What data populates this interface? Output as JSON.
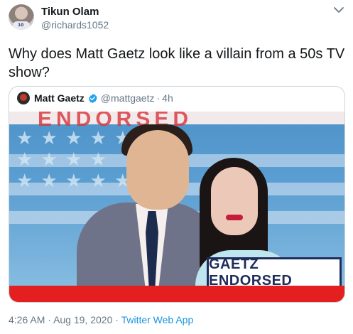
{
  "author": {
    "display_name": "Tikun Olam",
    "handle": "@richards1052"
  },
  "tweet": {
    "text": "Why does Matt Gaetz look like a villain from a 50s TV show?"
  },
  "quoted": {
    "display_name": "Matt Gaetz",
    "handle": "@mattgaetz",
    "separator": "·",
    "age": "4h",
    "verified": true,
    "media": {
      "overlay_text": "GAETZ ENDORSED",
      "banner_text": "ENDORSED"
    }
  },
  "meta": {
    "time": "4:26 AM",
    "date": "Aug 19, 2020",
    "separator": "·",
    "source": "Twitter Web App"
  },
  "colors": {
    "accent": "#1b95e0",
    "verified": "#1da1f2",
    "secondary_text": "#657786",
    "border": "#ccd6dd",
    "badge_navy": "#1f2d5c",
    "banner_red": "#e3201f"
  },
  "icons": {
    "caret": "chevron-down-icon",
    "verified": "verified-badge-icon"
  }
}
